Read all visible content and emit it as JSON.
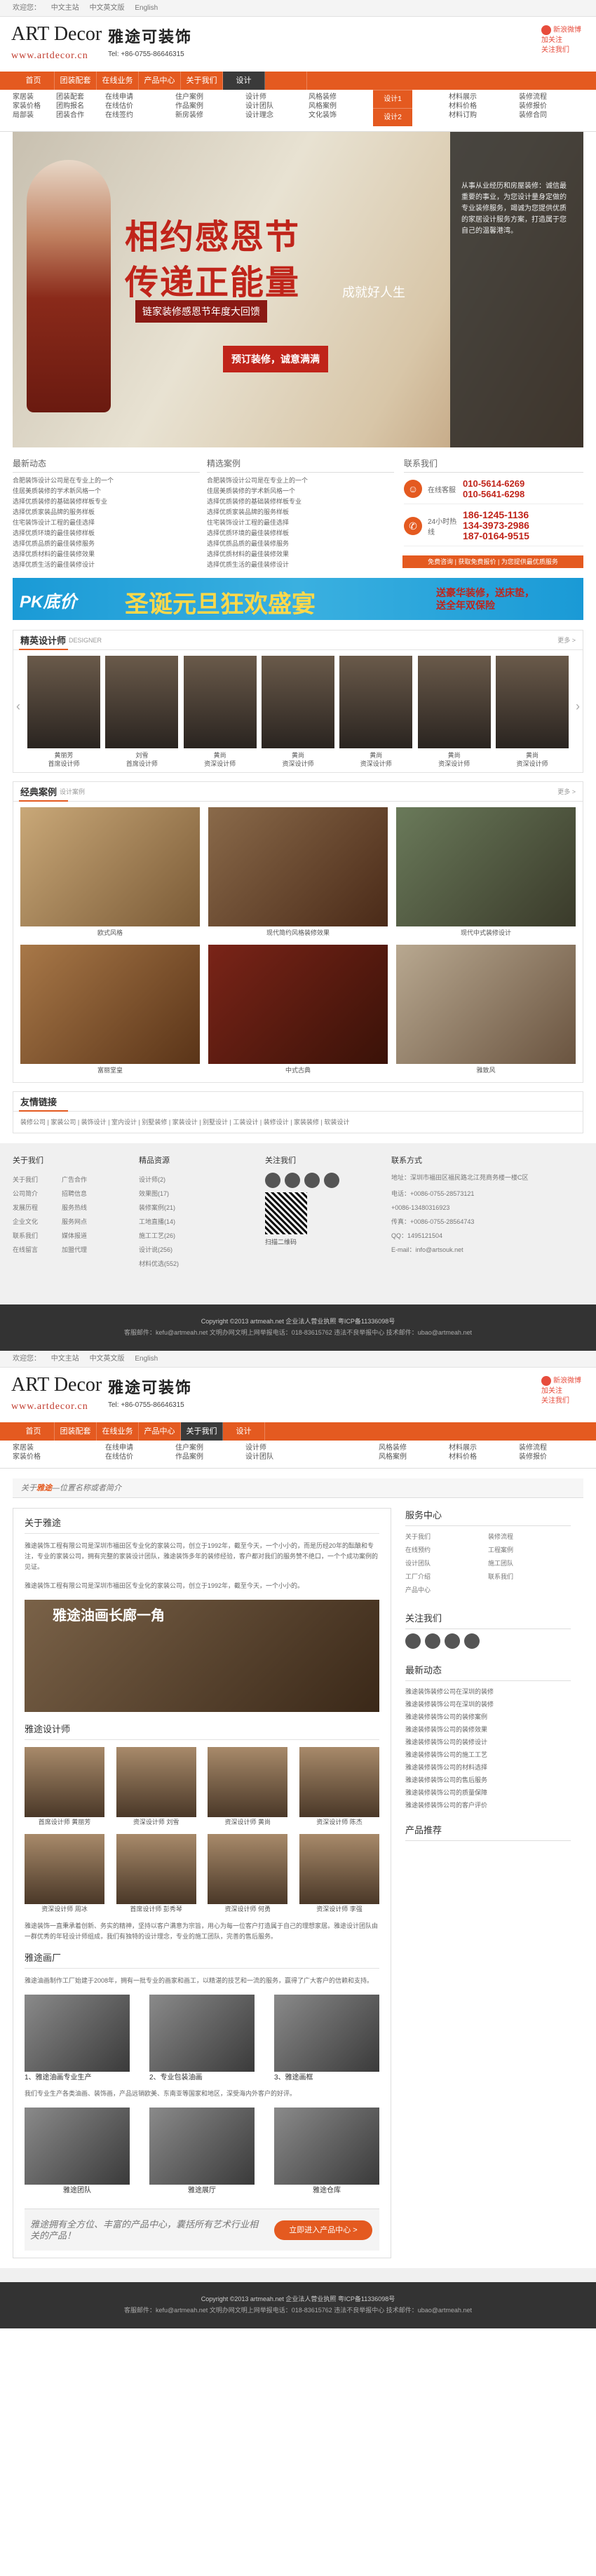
{
  "topbar": {
    "welcome": "欢迎您：",
    "items": [
      "中文主站",
      "中文英文版",
      "English"
    ]
  },
  "logo": {
    "brand": "ART Decor",
    "brand_cn": "雅途可装饰",
    "url": "www.artdecor.cn",
    "tel": "Tel: +86-0755-86646315"
  },
  "weibo": {
    "line1": "新浪微博",
    "line2": "加关注",
    "line3": "关注我们"
  },
  "nav": [
    "首页",
    "团装配套",
    "在线业务",
    "产品中心",
    "关于我们",
    "设计"
  ],
  "subnav": {
    "c1": [
      "家居装",
      "家装价格",
      "局部装"
    ],
    "c2": [
      "团装配套",
      "团购报名",
      "团装合作"
    ],
    "c3": [
      "在线申请",
      "在线估价",
      "在线签约"
    ],
    "c4": [
      "住户案例",
      "作品案例",
      "新房装修"
    ],
    "c5": [
      "设计师",
      "设计团队",
      "设计理念"
    ],
    "c6": [
      "风格装修",
      "风格案例",
      "文化装饰"
    ],
    "c7": [
      "材料展示",
      "材料价格",
      "材料订购"
    ],
    "c8": [
      "装修流程",
      "装修报价",
      "装修合同"
    ]
  },
  "design_drop": [
    "设计",
    "设计1",
    "设计2"
  ],
  "hero": {
    "title1": "相约感恩节",
    "title2": "传递正能量",
    "badge": "链家装修感恩节年度大回馈",
    "box": "预订装修，诚意满满",
    "stamp": "成就好人生",
    "panel": "从事从业经历和房屋装修：诚信最重要的事业，为您设计量身定做的专业装修服务，竭诚为您提供优质的家居设计服务方案，打造属于您自己的温馨港湾。"
  },
  "news": {
    "title": "最新动态",
    "items": [
      "合肥装饰设计公司是在专业上的一个",
      "佳居美质装修的学术新风格一个",
      "选择优质装修的基础装修样板专业",
      "选择优质家装品牌的服务样板",
      "住宅装饰设计工程的最佳选择",
      "选择优质环境的最佳装修样板",
      "选择优质品质的最佳装修服务",
      "选择优质材料的最佳装修效果",
      "选择优质生活的最佳装修设计"
    ]
  },
  "notice": {
    "title": "精选案例",
    "items": [
      "合肥装饰设计公司是在专业上的一个",
      "佳居美质装修的学术新风格一个",
      "选择优质装修的基础装修样板专业",
      "选择优质家装品牌的服务样板",
      "住宅装饰设计工程的最佳选择",
      "选择优质环境的最佳装修样板",
      "选择优质品质的最佳装修服务",
      "选择优质材料的最佳装修效果",
      "选择优质生活的最佳装修设计"
    ]
  },
  "contact": {
    "title": "联系我们",
    "hotline_label": "在线客服",
    "hotline": [
      "010-5614-6269",
      "010-5641-6298"
    ],
    "phone_label": "24小时热线",
    "phones": [
      "186-1245-1136",
      "134-3973-2986",
      "187-0164-9515"
    ],
    "promo": "免费咨询 | 获取免费报价 | 为您提供最优质服务"
  },
  "banner2": {
    "t1": "PK底价",
    "t2": "圣诞元旦狂欢盛宴",
    "t3": "送豪华装修，送床垫，送全年双保险"
  },
  "designers": {
    "title": "精英设计师",
    "sub": "DESIGNER",
    "more": "更多 >",
    "list": [
      {
        "name": "黄丽芳",
        "role": "首席设计师"
      },
      {
        "name": "刘雪",
        "role": "首席设计师"
      },
      {
        "name": "黄尚",
        "role": "资深设计师"
      },
      {
        "name": "黄尚",
        "role": "资深设计师"
      },
      {
        "name": "黄尚",
        "role": "资深设计师"
      },
      {
        "name": "黄尚",
        "role": "资深设计师"
      },
      {
        "name": "黄尚",
        "role": "资深设计师"
      }
    ]
  },
  "cases": {
    "title": "经典案例",
    "sub": "设计案例",
    "more": "更多 >",
    "list": [
      "欧式风格",
      "现代简约风格装修效果",
      "现代中式装修设计",
      "富丽堂皇",
      "中式古典",
      "雅致风"
    ]
  },
  "friends": {
    "title": "友情链接",
    "text": "装修公司 | 家装公司 | 装饰设计 | 室内设计 | 别墅装修 | 家装设计 | 别墅设计 | 工装设计 | 装修设计 | 家装装修 | 软装设计"
  },
  "footer": {
    "c1": {
      "title": "关于我们",
      "items": [
        "关于我们",
        "公司简介",
        "发展历程",
        "企业文化",
        "联系我们",
        "在线留言"
      ],
      "items2": [
        "广告合作",
        "招聘信息",
        "服务热线",
        "服务网点",
        "媒体报道",
        "加盟代理"
      ]
    },
    "c2": {
      "title": "精品资源",
      "items": [
        "设计师(2)",
        "效果图(17)",
        "装修案例(21)",
        "工地直播(14)",
        "施工工艺(26)",
        "设计说(256)",
        "材料优选(552)"
      ]
    },
    "c3": {
      "title": "关注我们",
      "qr_label": "扫描二维码"
    },
    "c4": {
      "title": "联系方式",
      "address": "地址：深圳市福田区福民路北江苑商务楼一楼C区",
      "phone": "电话：+0086-0755-28573121",
      "phone2": "+0086-13480316923",
      "fax": "传真：+0086-0755-28564743",
      "qq": "QQ：1495121504",
      "email": "E-mail：info@artsouk.net"
    }
  },
  "copy": {
    "line1": "Copyright ©2013  artmeah.net  企业法人营业执照  粤ICP备11336098号",
    "line2": "客服邮件：kefu@artmeah.net  文明办网文明上网举报电话：018-83615762  违法不良举报中心  技术邮件：ubao@artmeah.net"
  },
  "inner": {
    "breadcrumb_pre": "关于",
    "breadcrumb_hl": "雅途",
    "breadcrumb_post": "—位置名称或者简介",
    "about_title": "关于雅途",
    "about_p1": "雅途装饰工程有限公司是深圳市福田区专业化的家装公司，创立于1992年，截至今天，一个小小的，而是历经20年的酝酿和专注，专业的家装公司，拥有完整的家装设计团队，雅途装饰多年的装修经验，客户都对我们的服务赞不绝口，一个个成功案例的见证。",
    "about_p2": "雅途装饰工程有限公司是深圳市福田区专业化的家装公司，创立于1992年，截至今天，一个小小的。",
    "pic_label": "雅途油画长廊一角",
    "team_title": "雅途设计师",
    "team": [
      "首席设计师 黄丽芳",
      "资深设计师 刘雪",
      "资深设计师 黄尚",
      "资深设计师 陈杰",
      "资深设计师 周冰",
      "首席设计师 彭秀琴",
      "资深设计师 何勇",
      "资深设计师 李强"
    ],
    "team_p": "雅途装饰一直秉承着创新、务实的精神，坚持以客户满意为宗旨，用心为每一位客户打造属于自己的理想家居。雅途设计团队由一群优秀的年轻设计师组成，我们有独特的设计理念，专业的施工团队，完善的售后服务。",
    "factory_title": "雅途画厂",
    "factory_p": "雅途油画制作工厂始建于2008年，拥有一批专业的画家和画工，以精湛的技艺和一流的服务，赢得了广大客户的信赖和支持。",
    "factory_caps": [
      "1、雅途油画专业生产",
      "2、专业包装油画",
      "3、雅途画框"
    ],
    "factory_p2": "我们专业生产各类油画、装饰画，产品远销欧美、东南亚等国家和地区，深受海内外客户的好评。",
    "gallery": [
      "雅途团队",
      "雅途展厅",
      "雅途仓库"
    ],
    "cta": "雅途拥有全方位、丰富的产品中心，囊括所有艺术行业相关的产品！",
    "cta_btn": "立即进入产品中心 >",
    "side_title": "服务中心",
    "services": [
      "关于我们",
      "装修流程",
      "在线预约",
      "工程案例",
      "设计团队",
      "施工团队",
      "工厂介绍",
      "联系我们",
      "产品中心"
    ],
    "follow": "关注我们",
    "side_news_title": "最新动态",
    "side_news": [
      "雅途装饰装修公司在深圳的装修",
      "雅途装修装饰公司在深圳的装修",
      "雅途装修装饰公司的装修案例",
      "雅途装修装饰公司的装修效果",
      "雅途装修装饰公司的装修设计",
      "雅途装修装饰公司的施工工艺",
      "雅途装修装饰公司的材料选择",
      "雅途装修装饰公司的售后服务",
      "雅途装修装饰公司的质量保障",
      "雅途装修装饰公司的客户评价"
    ],
    "side_products": "产品推荐"
  }
}
